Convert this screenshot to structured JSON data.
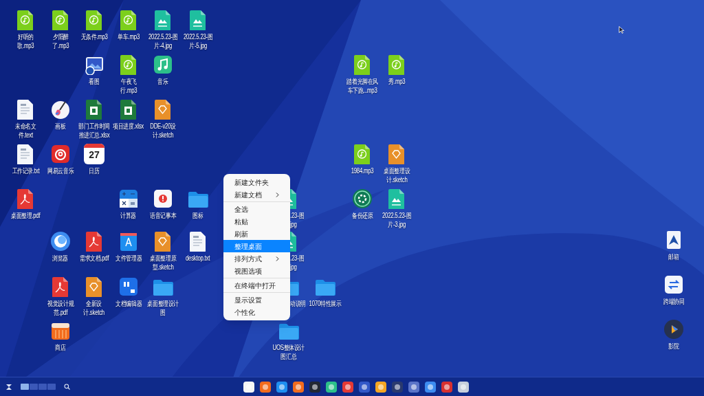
{
  "desktop": {
    "icons": [
      {
        "kind": "mp3",
        "label_lines": [
          "好听的",
          "歌.mp3"
        ]
      },
      {
        "kind": "mp3",
        "label_lines": [
          "夕阳醉",
          "了.mp3"
        ]
      },
      {
        "kind": "mp3",
        "label_lines": [
          "无条件.mp3"
        ]
      },
      {
        "kind": "mp3",
        "label_lines": [
          "单车.mp3"
        ]
      },
      {
        "kind": "jpg",
        "label_lines": [
          "2022.5.23-图",
          "片-4.jpg"
        ]
      },
      {
        "kind": "jpg",
        "label_lines": [
          "2022.5.23-图",
          "片-5.jpg"
        ]
      },
      {
        "kind": "viewer",
        "label_lines": [
          "看图"
        ]
      },
      {
        "kind": "mp3",
        "label_lines": [
          "午夜飞",
          "行.mp3"
        ]
      },
      {
        "kind": "music",
        "label_lines": [
          "音乐"
        ]
      },
      {
        "kind": "mp3",
        "label_lines": [
          "踏着光脚在风",
          "车下跑...mp3"
        ]
      },
      {
        "kind": "mp3",
        "label_lines": [
          "秀.mp3"
        ]
      },
      {
        "kind": "txt",
        "label_lines": [
          "未命名文",
          "件.text"
        ]
      },
      {
        "kind": "paint",
        "label_lines": [
          "画板"
        ]
      },
      {
        "kind": "xlsx",
        "label_lines": [
          "部门工作时间",
          "推进汇总.xlsx"
        ]
      },
      {
        "kind": "xlsx",
        "label_lines": [
          "项目进度.xlsx"
        ]
      },
      {
        "kind": "sketch",
        "label_lines": [
          "DDE-v20设",
          "计.sketch"
        ]
      },
      {
        "kind": "txt",
        "label_lines": [
          "工作记录.txt"
        ]
      },
      {
        "kind": "netease",
        "label_lines": [
          "网易云音乐"
        ]
      },
      {
        "kind": "calendar",
        "label_lines": [
          "日历"
        ],
        "day": "27"
      },
      {
        "kind": "mp3",
        "label_lines": [
          "1984.mp3"
        ]
      },
      {
        "kind": "sketch",
        "label_lines": [
          "桌面整理设",
          "计.sketch"
        ]
      },
      {
        "kind": "pdf",
        "label_lines": [
          "桌面整理.pdf"
        ]
      },
      {
        "kind": "calculator",
        "label_lines": [
          "计算器"
        ]
      },
      {
        "kind": "recorder",
        "label_lines": [
          "语音记事本"
        ]
      },
      {
        "kind": "folder",
        "label_lines": [
          "图标"
        ]
      },
      {
        "kind": "jpg",
        "label_lines": [
          ".23-图",
          "jpg"
        ]
      },
      {
        "kind": "backup",
        "label_lines": [
          "备份还原"
        ]
      },
      {
        "kind": "jpg",
        "label_lines": [
          "2022.5.23-图",
          "片-3.jpg"
        ]
      },
      {
        "kind": "browser",
        "label_lines": [
          "浏览器"
        ]
      },
      {
        "kind": "pdf",
        "label_lines": [
          "需求文档.pdf"
        ]
      },
      {
        "kind": "filemanager",
        "label_lines": [
          "文件管理器"
        ]
      },
      {
        "kind": "sketch",
        "label_lines": [
          "桌面整理原",
          "型.sketch"
        ]
      },
      {
        "kind": "txt",
        "label_lines": [
          "desktop.txt"
        ]
      },
      {
        "kind": "jpg",
        "label_lines": [
          ".23-图",
          "jpg"
        ]
      },
      {
        "kind": "mail",
        "label_lines": [
          "邮箱"
        ]
      },
      {
        "kind": "pdf",
        "label_lines": [
          "视觉设计规",
          "范.pdf"
        ]
      },
      {
        "kind": "sketch",
        "label_lines": [
          "全新设",
          "计.sketch"
        ]
      },
      {
        "kind": "editor",
        "label_lines": [
          "文档编辑器"
        ]
      },
      {
        "kind": "folder",
        "label_lines": [
          "桌面整理设计",
          "图"
        ]
      },
      {
        "kind": "folder",
        "label_lines": [
          "动说明"
        ]
      },
      {
        "kind": "folder",
        "label_lines": [
          "1070特性展示"
        ]
      },
      {
        "kind": "cooperate",
        "label_lines": [
          "跨端协同"
        ]
      },
      {
        "kind": "store",
        "label_lines": [
          "商店"
        ]
      },
      {
        "kind": "folder",
        "label_lines": [
          "UOS整体设计",
          "图汇总"
        ]
      },
      {
        "kind": "movie",
        "label_lines": [
          "影院"
        ]
      }
    ]
  },
  "context_menu": {
    "groups": [
      [
        {
          "label": "新建文件夹",
          "submenu": false,
          "selected": false
        },
        {
          "label": "新建文档",
          "submenu": true,
          "selected": false
        }
      ],
      [
        {
          "label": "全选",
          "submenu": false,
          "selected": false
        },
        {
          "label": "粘贴",
          "submenu": false,
          "selected": false
        },
        {
          "label": "刷新",
          "submenu": false,
          "selected": false
        },
        {
          "label": "整理桌面",
          "submenu": false,
          "selected": true
        },
        {
          "label": "排列方式",
          "submenu": true,
          "selected": false
        },
        {
          "label": "视图选项",
          "submenu": false,
          "selected": false
        }
      ],
      [
        {
          "label": "在终端中打开",
          "submenu": false,
          "selected": false
        }
      ],
      [
        {
          "label": "显示设置",
          "submenu": false,
          "selected": false
        },
        {
          "label": "个性化",
          "submenu": false,
          "selected": false
        }
      ]
    ]
  },
  "taskbar": {
    "workspaces": [
      {
        "selected": true
      },
      {
        "selected": false
      },
      {
        "selected": false
      },
      {
        "selected": false
      }
    ]
  }
}
